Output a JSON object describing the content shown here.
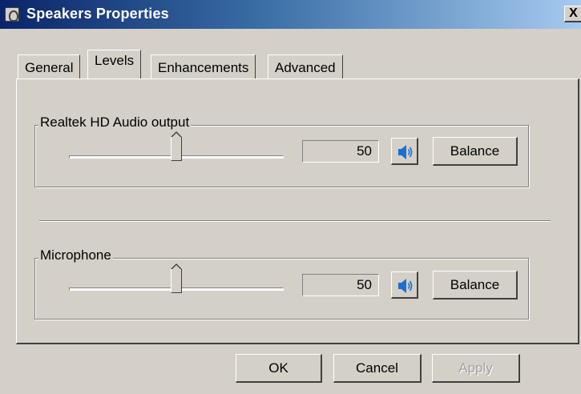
{
  "window": {
    "title": "Speakers Properties",
    "close_label": "X"
  },
  "tabs": [
    {
      "label": "General"
    },
    {
      "label": "Levels"
    },
    {
      "label": "Enhancements"
    },
    {
      "label": "Advanced"
    }
  ],
  "active_tab": "Levels",
  "groups": [
    {
      "legend": "Realtek HD Audio output",
      "level": 50,
      "value_text": "50",
      "balance_label": "Balance",
      "mute_icon": "speaker-icon"
    },
    {
      "legend": "Microphone",
      "level": 50,
      "value_text": "50",
      "balance_label": "Balance",
      "mute_icon": "speaker-icon"
    }
  ],
  "footer": {
    "ok_label": "OK",
    "cancel_label": "Cancel",
    "apply_label": "Apply"
  },
  "colors": {
    "face": "#d4d0c8",
    "title_start": "#0a246a",
    "title_end": "#a6caf0",
    "speaker_blue": "#1a6fd1"
  }
}
